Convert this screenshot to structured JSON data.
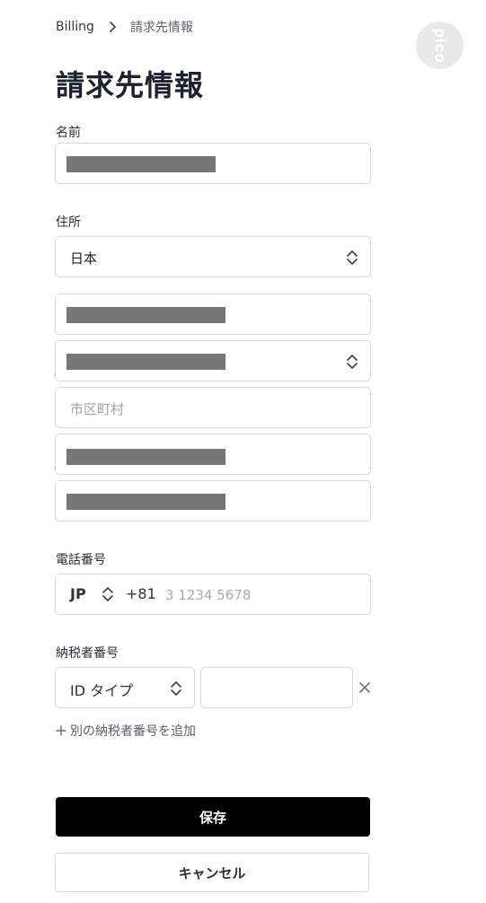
{
  "breadcrumb": {
    "parent": "Billing",
    "current": "請求先情報"
  },
  "avatar": {
    "initials": "pico"
  },
  "page_title": "請求先情報",
  "name_section": {
    "label": "名前",
    "value_redacted": true
  },
  "address_section": {
    "label": "住所",
    "country_value": "日本",
    "city_placeholder": "市区町村"
  },
  "phone_section": {
    "label": "電話番号",
    "country_code": "JP",
    "dial_prefix": "+81",
    "placeholder": "3 1234 5678"
  },
  "tax_section": {
    "label": "納税者番号",
    "id_type_label": "ID タイプ",
    "add_link": "別の納税者番号を追加"
  },
  "buttons": {
    "save": "保存",
    "cancel": "キャンセル"
  },
  "colors": {
    "primary_button": "#000000",
    "border": "#d6d8de",
    "redaction": "#767676"
  },
  "icons": {
    "breadcrumb_separator": "chevron-right-icon",
    "select_indicator": "chevron-updown-icon",
    "remove": "close-icon",
    "add": "plus-icon"
  }
}
